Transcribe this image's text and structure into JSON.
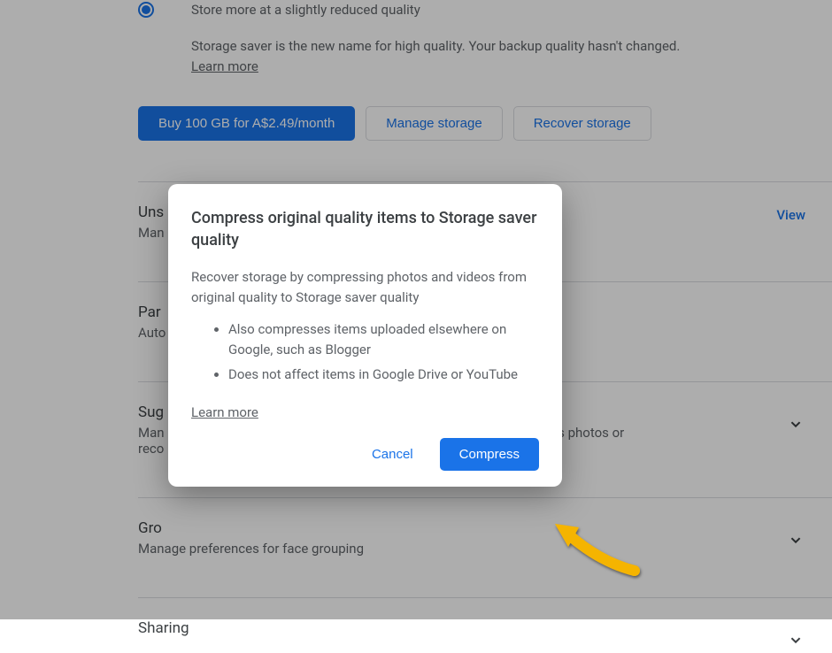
{
  "storage_option": {
    "subtitle": "Store more at a slightly reduced quality",
    "info_text": "Storage saver is the new name for high quality. Your backup quality hasn't changed.",
    "learn_more": "Learn more"
  },
  "buttons": {
    "buy_storage": "Buy 100 GB for A$2.49/month",
    "manage_storage": "Manage storage",
    "recover_storage": "Recover storage"
  },
  "sections": {
    "unsupported": {
      "title": "Uns",
      "subtitle": "Man",
      "action": "View"
    },
    "partner": {
      "title": "Par",
      "subtitle": "Auto"
    },
    "suggestions": {
      "title": "Sug",
      "subtitle_pre": "Man",
      "subtitle_mid": "ys photos or",
      "subtitle_post": "reco"
    },
    "grouping": {
      "title": "Gro",
      "subtitle": "Manage preferences for face grouping"
    },
    "sharing": {
      "title": "Sharing"
    }
  },
  "dialog": {
    "title": "Compress original quality items to Storage saver quality",
    "body": "Recover storage by compressing photos and videos from original quality to Storage saver quality",
    "bullets": [
      "Also compresses items uploaded elsewhere on Google, such as Blogger",
      "Does not affect items in Google Drive or YouTube"
    ],
    "learn_more": "Learn more",
    "cancel": "Cancel",
    "confirm": "Compress"
  },
  "colors": {
    "primary": "#1a73e8",
    "text": "#3c4043",
    "muted": "#5f6368",
    "arrow": "#f5b400"
  }
}
